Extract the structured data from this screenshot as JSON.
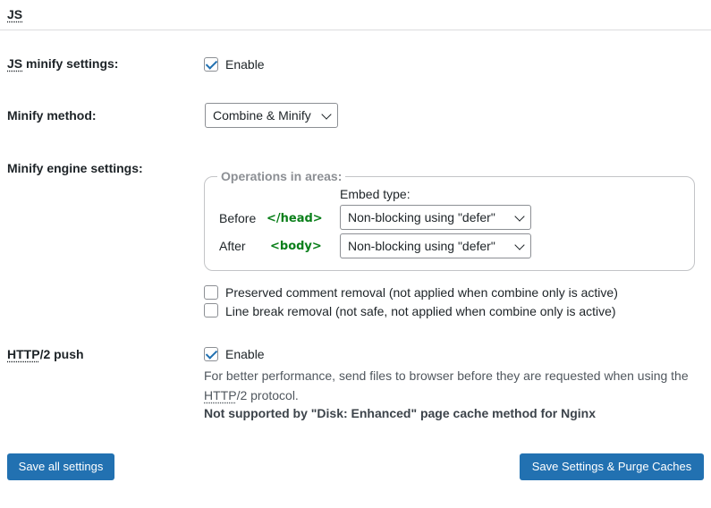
{
  "section": {
    "title": "JS"
  },
  "js_minify": {
    "label_abbr": "JS",
    "label_rest": " minify settings:",
    "checked": true,
    "enable_label": "Enable"
  },
  "minify_method": {
    "label": "Minify method:",
    "selected": "Combine & Minify"
  },
  "engine": {
    "label": "Minify engine settings:",
    "legend": "Operations in areas:",
    "embed_type_label": "Embed type:",
    "rows": [
      {
        "area": "Before",
        "tag": "</head>",
        "selected": "Non-blocking using \"defer\""
      },
      {
        "area": "After",
        "tag": "<body>",
        "selected": "Non-blocking using \"defer\""
      }
    ],
    "options": [
      {
        "label": "Preserved comment removal (not applied when combine only is active)",
        "checked": false
      },
      {
        "label": "Line break removal (not safe, not applied when combine only is active)",
        "checked": false
      }
    ]
  },
  "http2": {
    "label_abbr": "HTTP",
    "label_rest": "/2 push",
    "checked": true,
    "enable_label": "Enable",
    "desc_part1": "For better performance, send files to browser before they are requested when using the ",
    "desc_abbr": "HTTP",
    "desc_part2": "/2 protocol.",
    "note": "Not supported by \"Disk: Enhanced\" page cache method for Nginx"
  },
  "buttons": {
    "save_all": "Save all settings",
    "save_purge": "Save Settings & Purge Caches"
  }
}
